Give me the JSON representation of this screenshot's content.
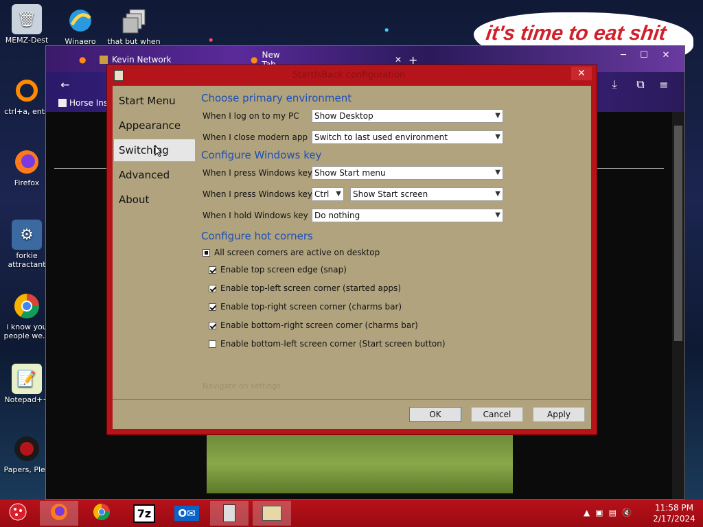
{
  "desktop": {
    "icons": [
      {
        "label": "MEMZ-Dest",
        "icon": "recycle-bin-icon"
      },
      {
        "label": "ctrl+a, ente",
        "icon": "ring-icon"
      },
      {
        "label": "Firefox",
        "icon": "firefox-icon"
      },
      {
        "label": "forkie attractant",
        "icon": "gear-monitor-icon"
      },
      {
        "label": "i know you people we...",
        "icon": "chrome-icon"
      },
      {
        "label": "Notepad++",
        "icon": "notepad-icon"
      },
      {
        "label": "Papers, Plea",
        "icon": "papers-please-icon"
      }
    ],
    "top_icons": [
      {
        "label": "Winaero",
        "icon": "winaero-icon"
      },
      {
        "label": "that but when",
        "icon": "stack-icon"
      }
    ],
    "meme_text": "it's time to eat shit"
  },
  "browser": {
    "tabs": [
      {
        "label": "Kevin Network",
        "icon": "favicon-icon"
      },
      {
        "label": "New Tab",
        "icon": "firefox-icon"
      }
    ],
    "bookmark": "Horse Ins"
  },
  "dialog": {
    "title": "StartIsBack configuration",
    "sidebar": [
      "Start Menu",
      "Appearance",
      "Switching",
      "Advanced",
      "About"
    ],
    "active_item": "Switching",
    "sections": {
      "primary_env": "Choose primary environment",
      "windows_key": "Configure Windows key",
      "hot_corners": "Configure hot corners"
    },
    "rows": {
      "logon_label": "When I log on to my PC",
      "logon_value": "Show Desktop",
      "close_label": "When I close modern app",
      "close_value": "Switch to last used environment",
      "press_label": "When I press Windows key",
      "press_value": "Show Start menu",
      "press_combo_label": "When I press Windows key +",
      "press_combo_mod": "Ctrl",
      "press_combo_value": "Show Start screen",
      "hold_label": "When I hold Windows key",
      "hold_value": "Do nothing"
    },
    "corners": [
      {
        "label": "All screen corners are active on desktop",
        "state": "partial"
      },
      {
        "label": "Enable top screen edge (snap)",
        "state": "checked"
      },
      {
        "label": "Enable top-left screen corner (started apps)",
        "state": "checked"
      },
      {
        "label": "Enable top-right screen corner (charms bar)",
        "state": "checked"
      },
      {
        "label": "Enable bottom-right screen corner (charms bar)",
        "state": "checked"
      },
      {
        "label": "Enable bottom-left screen corner (Start screen button)",
        "state": "unchecked"
      }
    ],
    "nav_hint": "Navigate on settings",
    "buttons": {
      "ok": "OK",
      "cancel": "Cancel",
      "apply": "Apply"
    }
  },
  "taskbar": {
    "apps": [
      "firefox-icon",
      "chrome-icon",
      "7zip-icon",
      "outlook-icon",
      "startisback-icon",
      "explorer-icon"
    ],
    "time": "11:58 PM",
    "date": "2/17/2024"
  },
  "colors": {
    "accent_red": "#b5141a",
    "dialog_bg": "#b0a37e",
    "section_blue": "#1f4fb4"
  }
}
